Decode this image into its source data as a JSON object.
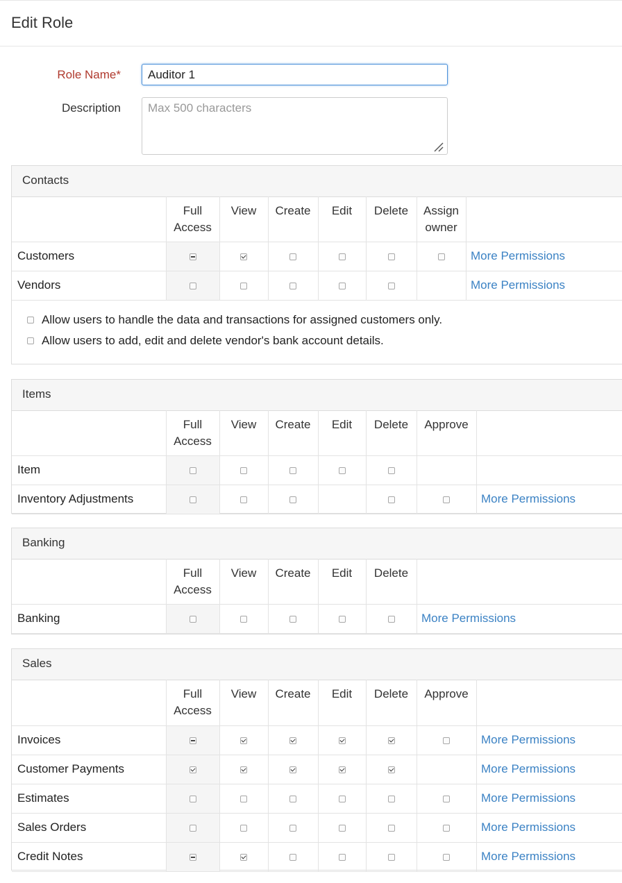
{
  "page": {
    "title": "Edit Role"
  },
  "form": {
    "role_name_label": "Role Name*",
    "role_name_value": "Auditor 1",
    "description_label": "Description",
    "description_placeholder": "Max 500 characters"
  },
  "more_permissions_label": "More Permissions",
  "contacts": {
    "title": "Contacts",
    "headers": [
      "Full\nAccess",
      "View",
      "Create",
      "Edit",
      "Delete",
      "Assign\nowner"
    ],
    "rows": [
      {
        "label": "Customers",
        "full": "indeterminate",
        "view": true,
        "create": false,
        "edit": false,
        "delete": false,
        "assign_owner": false,
        "more": true
      },
      {
        "label": "Vendors",
        "full": "unchecked",
        "view": false,
        "create": false,
        "edit": false,
        "delete": false,
        "assign_owner": null,
        "more": true
      }
    ],
    "options": [
      {
        "label": "Allow users to handle the data and transactions for assigned customers only.",
        "checked": false
      },
      {
        "label": "Allow users to add, edit and delete vendor's bank account details.",
        "checked": false
      }
    ]
  },
  "items": {
    "title": "Items",
    "headers": [
      "Full\nAccess",
      "View",
      "Create",
      "Edit",
      "Delete",
      "Approve"
    ],
    "rows": [
      {
        "label": "Item",
        "full": "unchecked",
        "view": false,
        "create": false,
        "edit": false,
        "delete": false,
        "approve": null,
        "more": false
      },
      {
        "label": "Inventory Adjustments",
        "full": "unchecked",
        "view": false,
        "create": false,
        "edit": null,
        "delete": false,
        "approve": false,
        "more": true
      }
    ]
  },
  "banking": {
    "title": "Banking",
    "headers": [
      "Full\nAccess",
      "View",
      "Create",
      "Edit",
      "Delete"
    ],
    "rows": [
      {
        "label": "Banking",
        "full": "unchecked",
        "view": false,
        "create": false,
        "edit": false,
        "delete": false,
        "more": true
      }
    ]
  },
  "sales": {
    "title": "Sales",
    "headers": [
      "Full\nAccess",
      "View",
      "Create",
      "Edit",
      "Delete",
      "Approve"
    ],
    "rows": [
      {
        "label": "Invoices",
        "full": "indeterminate",
        "view": true,
        "create": true,
        "edit": true,
        "delete": true,
        "approve": false,
        "more": true
      },
      {
        "label": "Customer Payments",
        "full": "checked",
        "view": true,
        "create": true,
        "edit": true,
        "delete": true,
        "approve": null,
        "more": true
      },
      {
        "label": "Estimates",
        "full": "unchecked",
        "view": false,
        "create": false,
        "edit": false,
        "delete": false,
        "approve": false,
        "more": true
      },
      {
        "label": "Sales Orders",
        "full": "unchecked",
        "view": false,
        "create": false,
        "edit": false,
        "delete": false,
        "approve": false,
        "more": true
      },
      {
        "label": "Credit Notes",
        "full": "indeterminate",
        "view": true,
        "create": false,
        "edit": false,
        "delete": false,
        "approve": false,
        "more": true
      }
    ]
  }
}
